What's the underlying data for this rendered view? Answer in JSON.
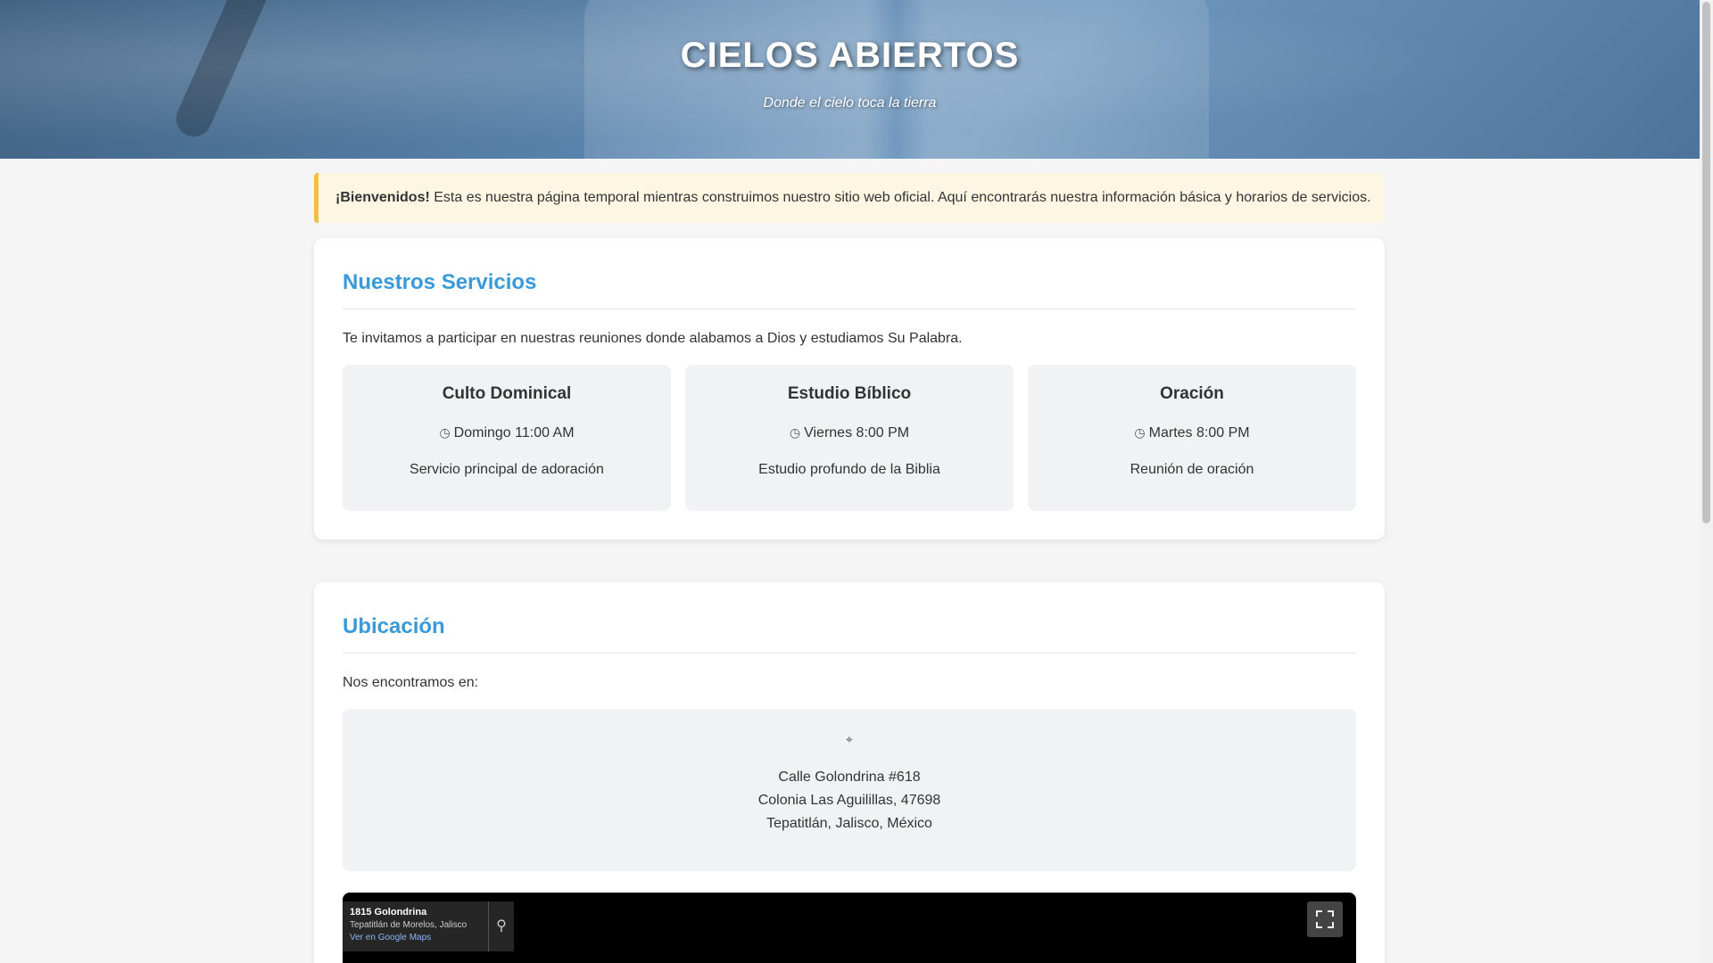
{
  "hero": {
    "title": "CIELOS ABIERTOS",
    "subtitle": "Donde el cielo toca la tierra"
  },
  "notice": {
    "bold": "¡Bienvenidos!",
    "text": " Esta es nuestra página temporal mientras construimos nuestro sitio web oficial. Aquí encontrarás nuestra información básica y horarios de servicios."
  },
  "services": {
    "heading": "Nuestros Servicios",
    "intro": "Te invitamos a participar en nuestras reuniones donde alabamos a Dios y estudiamos Su Palabra.",
    "items": [
      {
        "title": "Culto Dominical",
        "time": "Domingo 11:00 AM",
        "description": "Servicio principal de adoración",
        "icon": "clock-icon"
      },
      {
        "title": "Estudio Bíblico",
        "time": "Viernes 8:00 PM",
        "description": "Estudio profundo de la Biblia",
        "icon": "clock-icon"
      },
      {
        "title": "Oración",
        "time": "Martes 8:00 PM",
        "description": "Reunión de oración",
        "icon": "clock-icon"
      }
    ]
  },
  "location": {
    "heading": "Ubicación",
    "intro": "Nos encontramos en:",
    "icon": "map-pin-icon",
    "address": [
      "Calle Golondrina #618",
      "Colonia Las Aguilillas, 47698",
      "Tepatitlán, Jalisco, México"
    ]
  },
  "map": {
    "place": "1815 Golondrina",
    "city": "Tepatitlán de Morelos, Jalisco",
    "link": "Ver en Google Maps",
    "directions_icon": "directions-pin-icon",
    "fullscreen_icon": "fullscreen-icon"
  },
  "colors": {
    "accent": "#3a9ad9",
    "notice_border": "#f0c040",
    "notice_bg": "#fdf6e3",
    "card_inner": "#f0f2f4"
  }
}
